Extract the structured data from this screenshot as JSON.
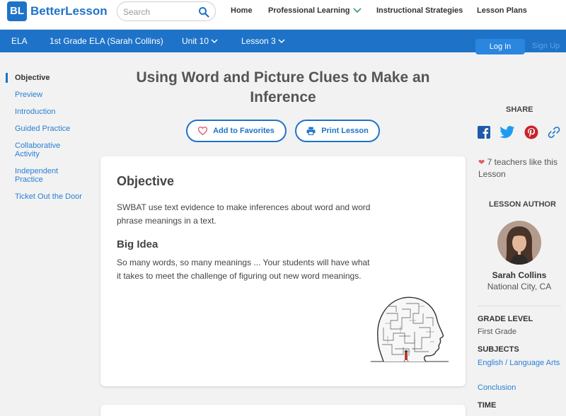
{
  "header": {
    "logo_mark": "BL",
    "logo_text": "BetterLesson",
    "search_placeholder": "Search",
    "nav": [
      "Home",
      "Professional Learning",
      "Instructional Strategies",
      "Lesson Plans"
    ]
  },
  "coursebar": {
    "crumbs": [
      "ELA",
      "1st Grade ELA (Sarah Collins)",
      "Unit 10",
      "Lesson 3"
    ],
    "login": "Log In",
    "signup": "Sign Up"
  },
  "sidenav": {
    "items": [
      "Objective",
      "Preview",
      "Introduction",
      "Guided Practice",
      "Collaborative Activity",
      "Independent Practice",
      "Ticket Out the Door"
    ],
    "active_index": 0
  },
  "lesson": {
    "title": "Using Word and Picture Clues to Make an Inference",
    "add_favorites": "Add to Favorites",
    "print": "Print Lesson",
    "objective_heading": "Objective",
    "objective_text": "SWBAT use text evidence to make inferences about word and word phrase meanings in a text.",
    "big_idea_heading": "Big Idea",
    "big_idea_text": "So many words, so many meanings ... Your students will have what it takes to meet the challenge of figuring out new word meanings."
  },
  "rail": {
    "share_label": "SHARE",
    "social_icons": [
      "facebook-icon",
      "twitter-icon",
      "pinterest-icon",
      "link-icon"
    ],
    "likes_text": "7 teachers like this Lesson",
    "author_label": "LESSON AUTHOR",
    "author_name": "Sarah Collins",
    "author_location": "National City, CA",
    "grade_label": "GRADE LEVEL",
    "grade_value": "First Grade",
    "subjects_label": "SUBJECTS",
    "subjects": [
      "English / Language Arts",
      "Conclusion"
    ],
    "time_label": "TIME"
  },
  "colors": {
    "brand_blue": "#1e73c9",
    "link_blue": "#2a7fd4",
    "heart_red": "#e05a66"
  }
}
